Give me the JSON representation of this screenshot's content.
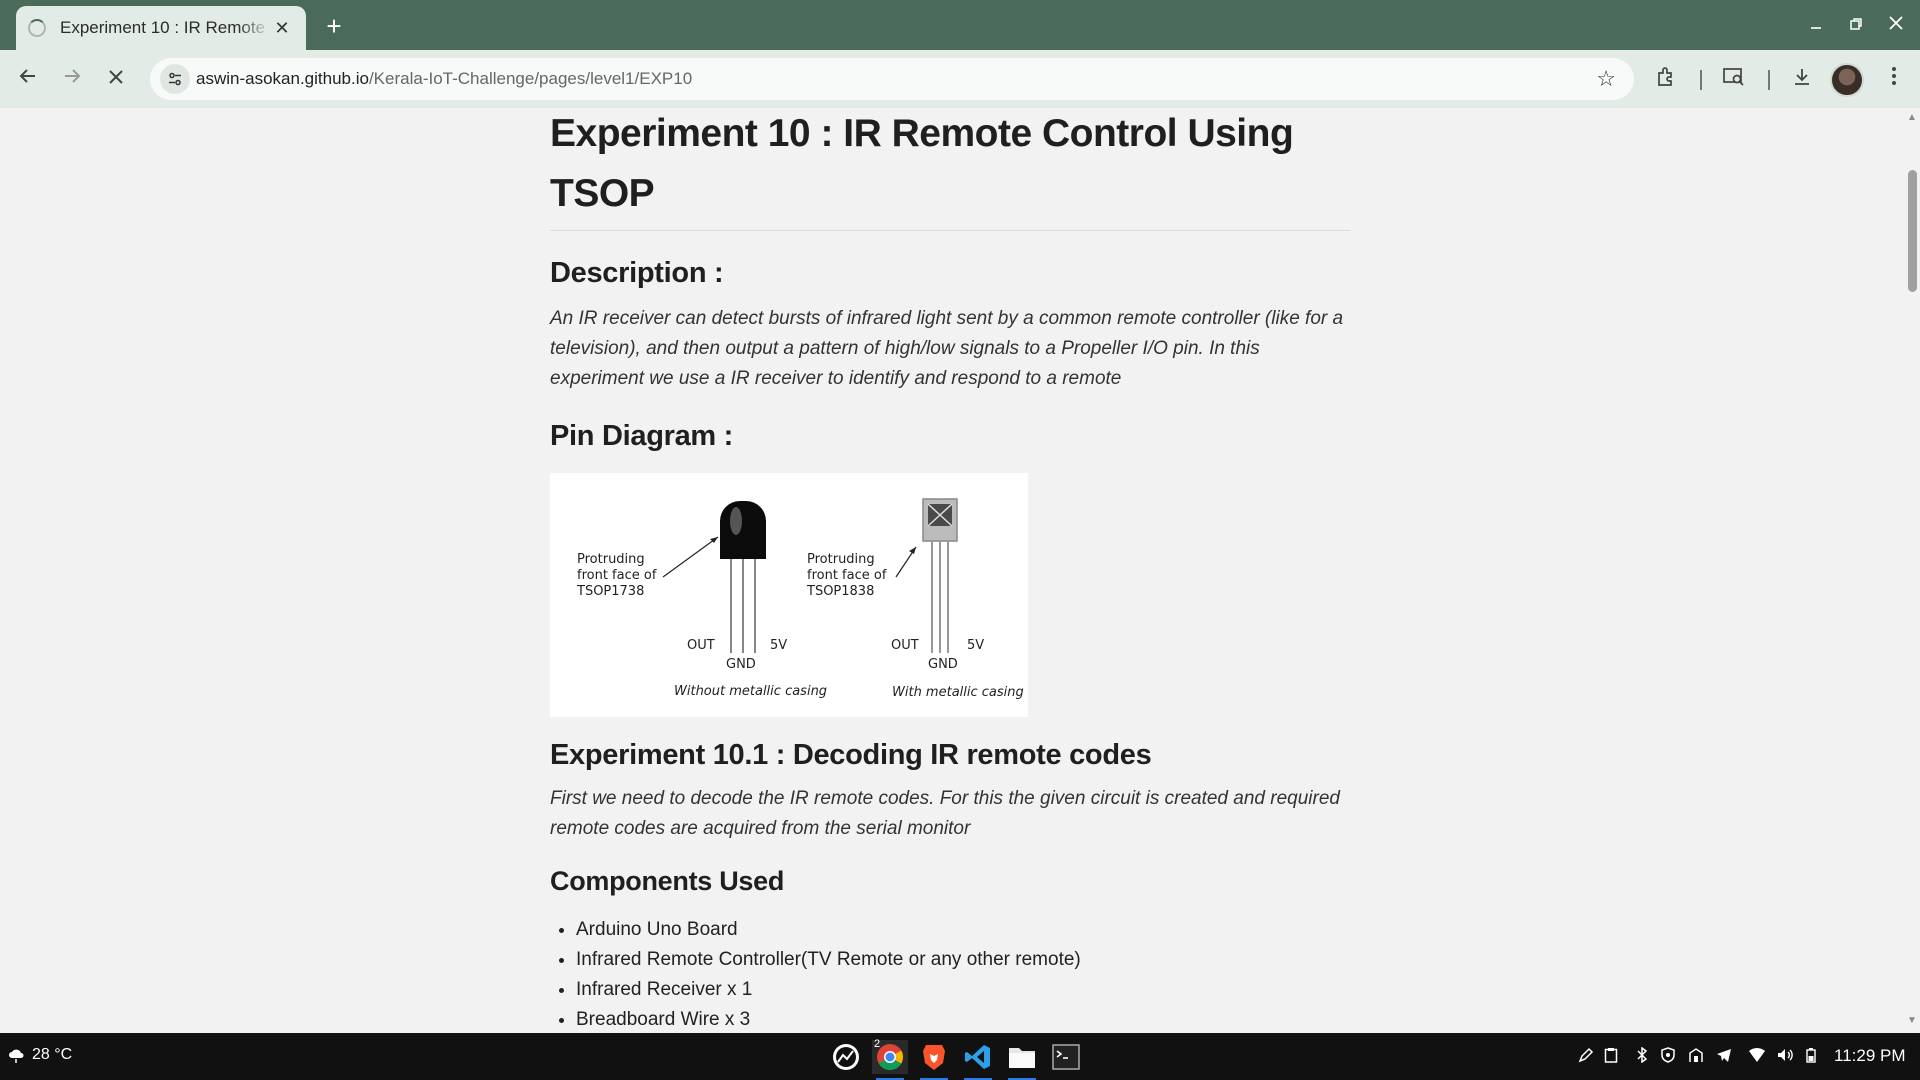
{
  "browser": {
    "tab_title": "Experiment 10 : IR Remote Control Using TSOP",
    "tab_close": "✕",
    "new_tab": "+",
    "url_host": "aswin-asokan.github.io",
    "url_path": "/Kerala-IoT-Challenge/pages/level1/EXP10"
  },
  "page": {
    "title": "Experiment 10 : IR Remote Control Using TSOP",
    "description_heading": "Description :",
    "description_text": "An IR receiver can detect bursts of infrared light sent by a common remote controller (like for a television), and then output a pattern of high/low signals to a Propeller I/O pin. In this experiment we use a IR receiver to identify and respond to a remote",
    "pin_heading": "Pin Diagram :",
    "figure": {
      "left_label_1": "Protruding",
      "left_label_2": "front face of",
      "left_label_3": "TSOP1738",
      "right_label_1": "Protruding",
      "right_label_2": "front face of",
      "right_label_3": "TSOP1838",
      "out": "OUT",
      "gnd": "GND",
      "v5": "5V",
      "caption_left": "Without metallic casing",
      "caption_right": "With metallic casing"
    },
    "exp_heading": "Experiment 10.1 : Decoding IR remote codes",
    "exp_text": "First we need to decode the IR remote codes. For this the given circuit is created and required remote codes are acquired from the serial monitor",
    "components_heading": "Components Used",
    "components": [
      "Arduino Uno Board",
      "Infrared Remote Controller(TV Remote or any other remote)",
      "Infrared Receiver x 1",
      "Breadboard Wire x 3"
    ]
  },
  "taskbar": {
    "weather": "28 °C",
    "chrome_badge": "2",
    "time": "11:29 PM"
  }
}
